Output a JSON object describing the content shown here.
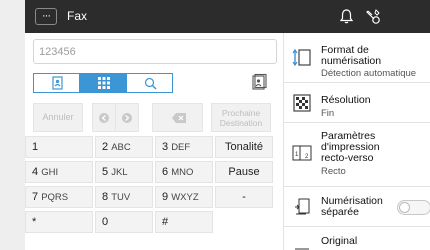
{
  "header": {
    "title": "Fax",
    "menu_label": "···"
  },
  "number_input": {
    "placeholder": "123456"
  },
  "mode_tabs": [
    {
      "name": "address-book",
      "icon": "address-book-icon",
      "active": false
    },
    {
      "name": "keypad",
      "icon": "keypad-icon",
      "active": true
    },
    {
      "name": "search",
      "icon": "search-icon",
      "active": false
    }
  ],
  "hint_buttons": {
    "cancel": "Annuler",
    "next_line1": "Prochaine",
    "next_line2": "Destination"
  },
  "keypad": {
    "rows": [
      [
        {
          "n": "1",
          "l": ""
        },
        {
          "n": "2",
          "l": "ABC"
        },
        {
          "n": "3",
          "l": "DEF"
        }
      ],
      [
        {
          "n": "4",
          "l": "GHI"
        },
        {
          "n": "5",
          "l": "JKL"
        },
        {
          "n": "6",
          "l": "MNO"
        }
      ],
      [
        {
          "n": "7",
          "l": "PQRS"
        },
        {
          "n": "8",
          "l": "TUV"
        },
        {
          "n": "9",
          "l": "WXYZ"
        }
      ],
      [
        {
          "n": "*",
          "l": ""
        },
        {
          "n": "0",
          "l": ""
        },
        {
          "n": "#",
          "l": ""
        }
      ]
    ],
    "side": [
      "Tonalité",
      "Pause",
      "-",
      ""
    ]
  },
  "settings": [
    {
      "title": "Format de numérisation",
      "title1": "Format de",
      "title2": "numérisation",
      "sub": "Détection automatique",
      "icon": "scan-size-icon"
    },
    {
      "title": "Résolution",
      "title1": "Résolution",
      "title2": "",
      "sub": "Fin",
      "icon": "resolution-icon"
    },
    {
      "title1": "Paramètres",
      "title2": "d'impression",
      "title3": "recto-verso",
      "sub": "Recto",
      "icon": "duplex-icon"
    },
    {
      "title1": "Numérisation",
      "title2": "séparée",
      "icon": "separate-scan-icon",
      "toggle": false
    },
    {
      "title1": "Original",
      "icon": "original-icon"
    }
  ],
  "colors": {
    "accent": "#3c95d4",
    "topbar": "#2c2c2c"
  }
}
